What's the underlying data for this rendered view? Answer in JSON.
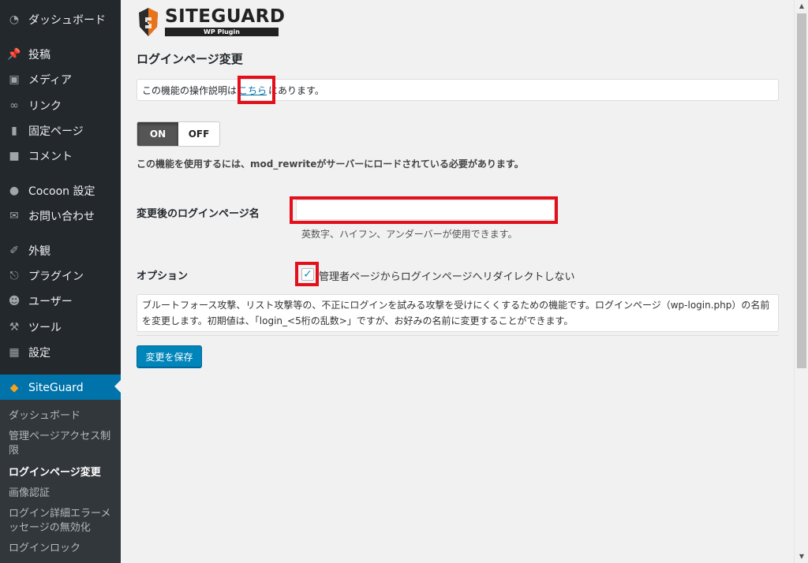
{
  "sidebar": {
    "items": [
      {
        "label": "ダッシュボード",
        "icon": "dashboard-icon"
      },
      {
        "label": "投稿",
        "icon": "pin-icon"
      },
      {
        "label": "メディア",
        "icon": "media-icon"
      },
      {
        "label": "リンク",
        "icon": "link-icon"
      },
      {
        "label": "固定ページ",
        "icon": "page-icon"
      },
      {
        "label": "コメント",
        "icon": "comment-icon"
      },
      {
        "label": "Cocoon 設定",
        "icon": "circle-icon"
      },
      {
        "label": "お問い合わせ",
        "icon": "mail-icon"
      },
      {
        "label": "外観",
        "icon": "brush-icon"
      },
      {
        "label": "プラグイン",
        "icon": "plugin-icon"
      },
      {
        "label": "ユーザー",
        "icon": "user-icon"
      },
      {
        "label": "ツール",
        "icon": "wrench-icon"
      },
      {
        "label": "設定",
        "icon": "settings-icon"
      },
      {
        "label": "SiteGuard",
        "icon": "shield-icon"
      }
    ],
    "submenu": [
      "ダッシュボード",
      "管理ページアクセス制限",
      "ログインページ変更",
      "画像認証",
      "ログイン詳細エラーメッセージの無効化",
      "ログインロック"
    ]
  },
  "logo": {
    "name": "SITEGUARD",
    "sub": "WP Plugin"
  },
  "main": {
    "title": "ログインページ変更",
    "info_prefix": "この機能の操作説明は",
    "info_link": "こちら",
    "info_suffix": "にあります。",
    "toggle_on": "ON",
    "toggle_off": "OFF",
    "mod_note": "この機能を使用するには、mod_rewriteがサーバーにロードされている必要があります。",
    "name_label": "変更後のログインページ名",
    "name_value": "",
    "name_hint": "英数字、ハイフン、アンダーバーが使用できます。",
    "option_label": "オプション",
    "option_check_text": "管理者ページからログインページへリダイレクトしない",
    "option_checked": true,
    "description": "ブルートフォース攻撃、リスト攻撃等の、不正にログインを試みる攻撃を受けにくくするための機能です。ログインページ（wp-login.php）の名前を変更します。初期値は、「login_<5桁の乱数>」ですが、お好みの名前に変更することができます。",
    "save_label": "変更を保存"
  },
  "colors": {
    "sidebar_bg": "#23282d",
    "accent": "#0073aa",
    "highlight": "#e3101c"
  }
}
